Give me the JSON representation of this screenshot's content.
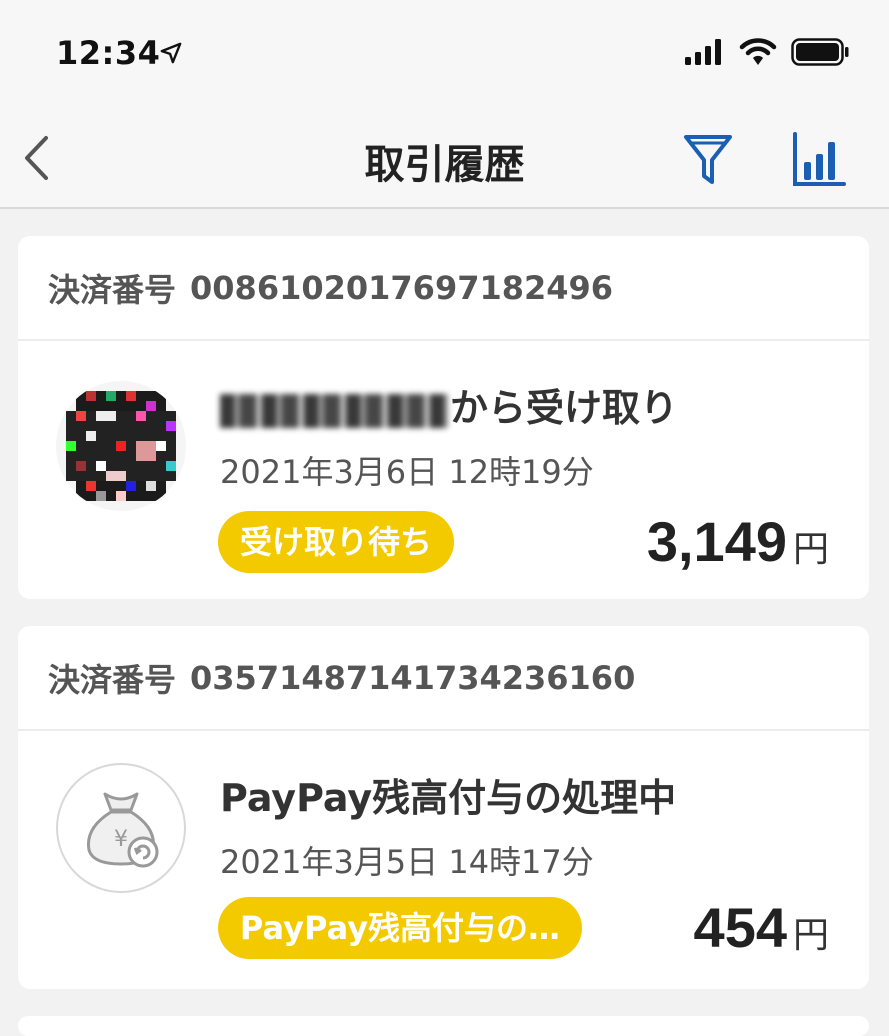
{
  "status_bar": {
    "time": "12:34"
  },
  "nav": {
    "title": "取引履歴"
  },
  "transactions": [
    {
      "id_label": "決済番号",
      "id_number": "0086102017697182496",
      "title_suffix": "から受け取り",
      "date": "2021年3月6日 12時19分",
      "badge": "受け取り待ち",
      "amount": "3,149",
      "currency": "円"
    },
    {
      "id_label": "決済番号",
      "id_number": "0357148714173423616​0",
      "title": "PayPay残高付与の処理中",
      "date": "2021年3月5日 14時17分",
      "badge": "PayPay残高付与の…",
      "amount": "454",
      "currency": "円"
    }
  ],
  "colors": {
    "accent_yellow": "#f3c900",
    "icon_blue": "#1a5fb4"
  }
}
